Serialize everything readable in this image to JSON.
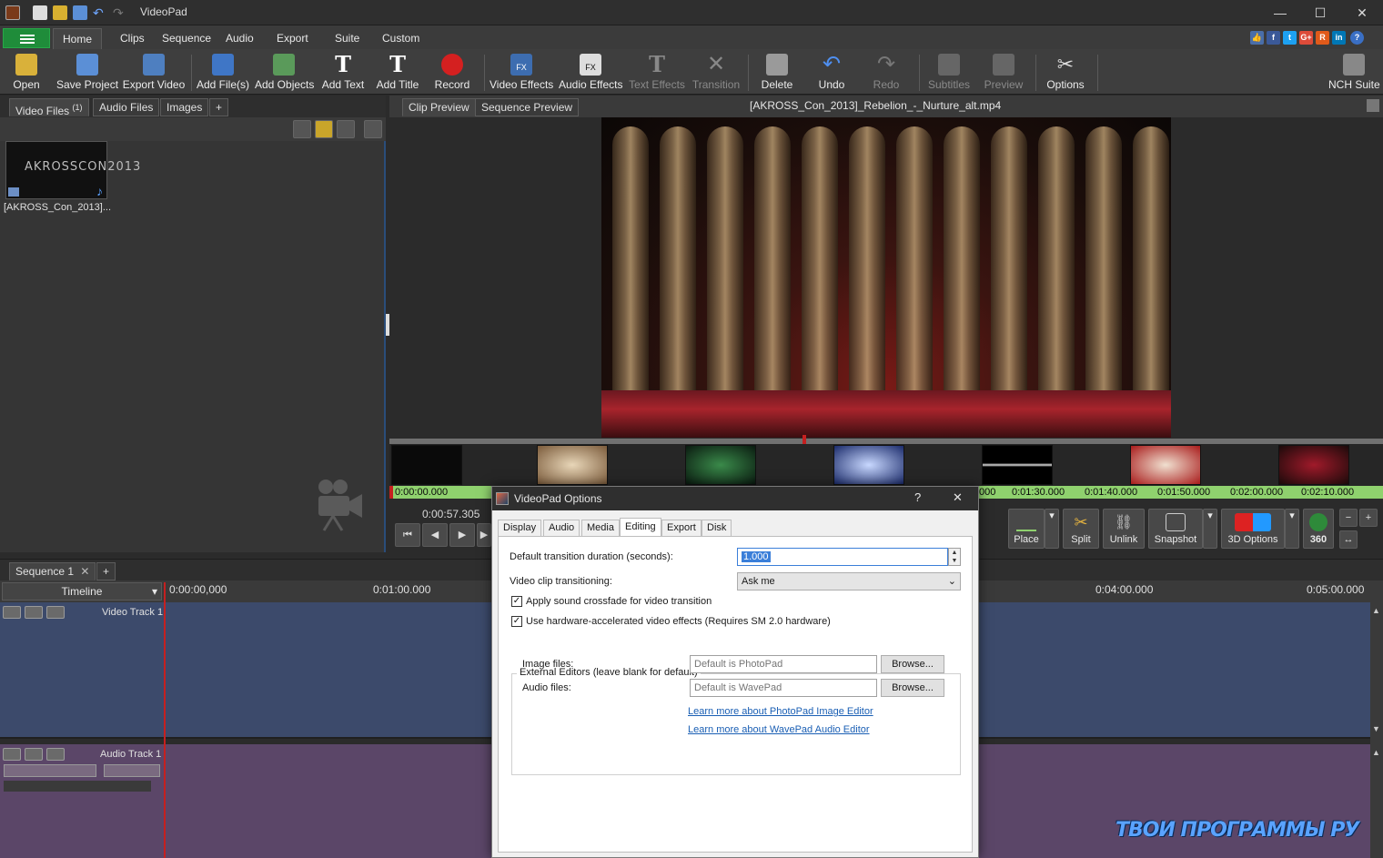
{
  "window": {
    "title": "VideoPad",
    "controls": [
      "—",
      "☐",
      "✕"
    ]
  },
  "ribbon": {
    "tabs": [
      "Home",
      "Clips",
      "Sequence",
      "Audio",
      "Export",
      "Suite",
      "Custom"
    ],
    "active_tab": "Home",
    "social": [
      "f",
      "t",
      "G+",
      "R",
      "in",
      "?"
    ]
  },
  "toolbar": {
    "open": "Open",
    "save_project": "Save Project",
    "export_video": "Export Video",
    "add_files": "Add File(s)",
    "add_objects": "Add Objects",
    "add_text": "Add Text",
    "add_title": "Add Title",
    "record": "Record",
    "video_effects": "Video Effects",
    "audio_effects": "Audio Effects",
    "text_effects": "Text Effects",
    "transition": "Transition",
    "delete": "Delete",
    "undo": "Undo",
    "redo": "Redo",
    "subtitles": "Subtitles",
    "preview": "Preview",
    "options": "Options",
    "nch_suite": "NCH Suite"
  },
  "media_bin": {
    "tabs": {
      "video_files": "Video Files",
      "video_count": "(1)",
      "audio_files": "Audio Files",
      "images": "Images",
      "add": "+"
    },
    "clip": {
      "thumb_text": "AKROSSCON2013",
      "name": "[AKROSS_Con_2013]..."
    }
  },
  "preview": {
    "tabs": {
      "clip_preview": "Clip Preview",
      "sequence_preview": "Sequence Preview"
    },
    "file_title": "[AKROSS_Con_2013]_Rebelion_-_Nurture_alt.mp4",
    "time_readout": "0:00:57.305",
    "ruler_labels": [
      "0:00:00.000",
      "000",
      "0:01:30.000",
      "0:01:40.000",
      "0:01:50.000",
      "0:02:00.000",
      "0:02:10.000"
    ],
    "edit_tools": {
      "place": "Place",
      "split": "Split",
      "unlink": "Unlink",
      "snapshot": "Snapshot",
      "options_3d": "3D Options",
      "vr_360": "360"
    }
  },
  "sequence": {
    "tab_label": "Sequence 1",
    "add_tab": "+",
    "timeline_mode": "Timeline",
    "ruler_labels": [
      "0:00:00,000",
      "0:01:00.000",
      "0:04:00.000",
      "0:05:00.000"
    ],
    "video_track": "Video Track 1",
    "audio_track": "Audio Track 1"
  },
  "dialog": {
    "title": "VideoPad Options",
    "help": "?",
    "close": "✕",
    "tabs": [
      "Display",
      "Audio",
      "Media",
      "Editing",
      "Export",
      "Disk"
    ],
    "active_tab": "Editing",
    "transition_duration_label": "Default transition duration (seconds):",
    "transition_duration_value": "1.000",
    "transitioning_label": "Video clip transitioning:",
    "transitioning_value": "Ask me",
    "crossfade_label": "Apply sound crossfade for video transition",
    "crossfade_checked": true,
    "hw_accel_label": "Use hardware-accelerated video effects (Requires SM 2.0 hardware)",
    "hw_accel_checked": true,
    "external_editors_label": "External Editors (leave blank for default)",
    "image_files_label": "Image files:",
    "image_files_placeholder": "Default is PhotoPad",
    "audio_files_label": "Audio files:",
    "audio_files_placeholder": "Default is WavePad",
    "browse": "Browse...",
    "photopad_link": "Learn more about PhotoPad Image Editor",
    "wavepad_link": "Learn more about WavePad Audio Editor"
  },
  "watermark": "ТВОИ ПРОГРАММЫ РУ"
}
